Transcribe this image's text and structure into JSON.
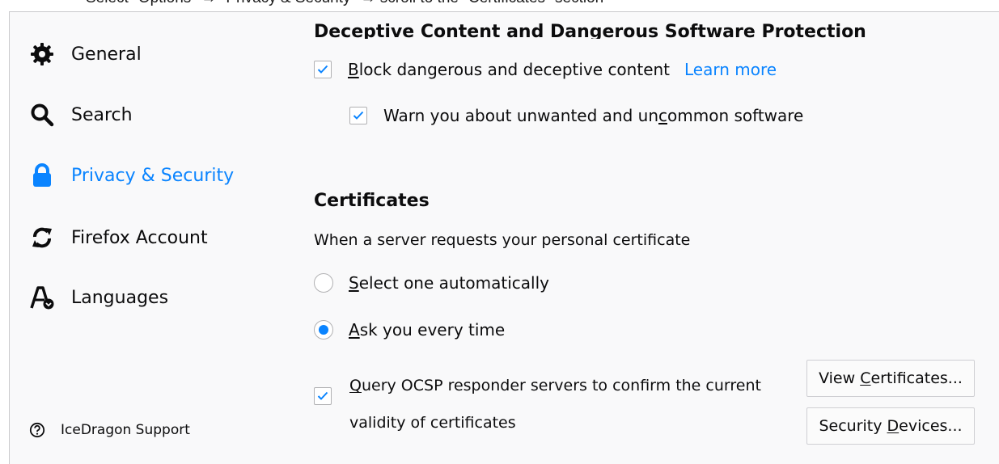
{
  "caption": "Select \"Options\" → \"Privacy & Security\" → scroll to the \"Certificates\" section",
  "sidebar": {
    "items": [
      {
        "label": "General",
        "icon": "gear-icon",
        "selected": false
      },
      {
        "label": "Search",
        "icon": "search-icon",
        "selected": false
      },
      {
        "label": "Privacy & Security",
        "icon": "lock-icon",
        "selected": true
      },
      {
        "label": "Firefox Account",
        "icon": "sync-icon",
        "selected": false
      },
      {
        "label": "Languages",
        "icon": "languages-icon",
        "selected": false
      }
    ],
    "support_label": "IceDragon Support"
  },
  "deceptive": {
    "heading": "Deceptive Content and Dangerous Software Protection",
    "block": {
      "pre": "",
      "u": "B",
      "post": "lock dangerous and deceptive content",
      "checked": true
    },
    "learn_more": "Learn more",
    "warn": {
      "pre": "Warn you about unwanted and un",
      "u": "c",
      "post": "ommon software",
      "checked": true
    }
  },
  "certificates": {
    "title": "Certificates",
    "description": "When a server requests your personal certificate",
    "select_auto": {
      "pre": "",
      "u": "S",
      "post": "elect one automatically",
      "selected": false
    },
    "ask_every": {
      "pre": "",
      "u": "A",
      "post": "sk you every time",
      "selected": true
    },
    "ocsp": {
      "u": "Q",
      "line1_post": "uery OCSP responder servers to confirm the current",
      "line2": "validity of certificates",
      "checked": true
    },
    "view_btn": {
      "pre": "View ",
      "u": "C",
      "post": "ertificates..."
    },
    "devices_btn": {
      "pre": "Security ",
      "u": "D",
      "post": "evices..."
    }
  },
  "colors": {
    "accent": "#0a84ff",
    "background": "#f9f9fa"
  }
}
